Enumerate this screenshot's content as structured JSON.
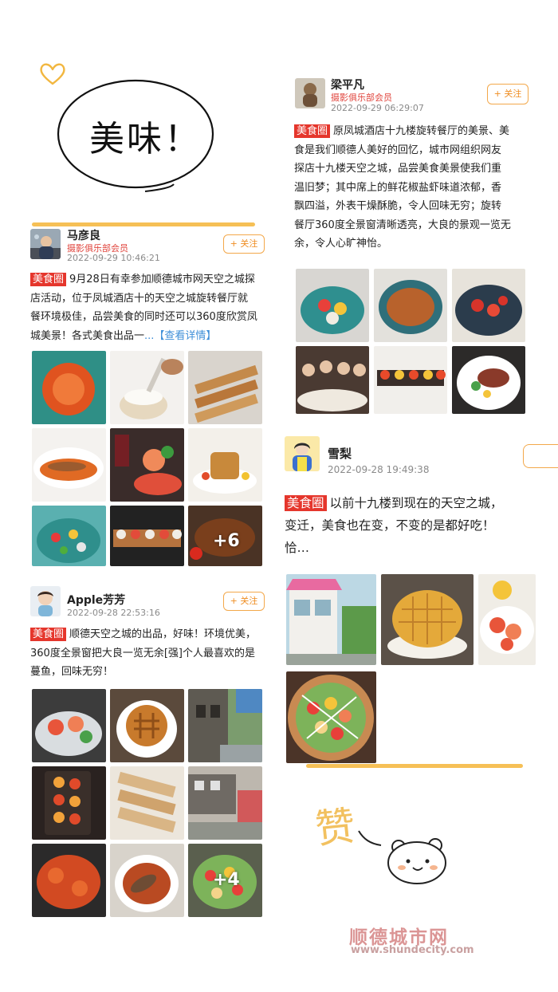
{
  "header": {
    "title": "美味！"
  },
  "posts": [
    {
      "name": "马彦良",
      "club": "摄影俱乐部会员",
      "time": "2022-09-29 10:46:21",
      "follow": "+ 关注",
      "tag": "美食圈",
      "lines": [
        "9月28日有幸参加顺德城市网天空之城探",
        "店活动，位于凤城酒店十的天空之城旋转餐厅就",
        "餐环境极佳，品尝美食的同时还可以360度欣赏凤",
        "城美景！各式美食出品一"
      ],
      "more": "...【查看详情】",
      "extra_count": "+6"
    },
    {
      "name": "Apple芳芳",
      "time": "2022-09-28 22:53:16",
      "follow": "+ 关注",
      "tag": "美食圈",
      "lines": [
        "顺德天空之城的出品，好味！环境优美，",
        "360度全景窗把大良一览无余[强]个人最喜欢的是",
        "蔓鱼，回味无穷！"
      ],
      "extra_count": "+4"
    },
    {
      "name": "梁平凡",
      "club": "摄影俱乐部会员",
      "time": "2022-09-29 06:29:07",
      "follow": "+ 关注",
      "tag": "美食圈",
      "lines": [
        "原凤城酒店十九楼旋转餐厅的美景、美",
        "食是我们顺德人美好的回忆，城市网组织网友",
        "探店十九楼天空之城，品尝美食美景使我们重",
        "温旧梦；其中席上的鲜花椒盐虾味道浓郁，香",
        "飘四溢，外表干燥酥脆，令人回味无穷；旋转",
        "餐厅360度全景窗清晰透亮，大良的景观一览无",
        "余，令人心旷神怡。"
      ]
    },
    {
      "name": "雪梨",
      "time": "2022-09-28 19:49:38",
      "tag": "美食圈",
      "lines": [
        "以前十九楼到现在的天空之城，",
        "变迁，美食也在变，不变的是都好吃！",
        "恰…"
      ]
    }
  ],
  "decor": {
    "zan": "赞"
  },
  "watermark": {
    "cn": "顺德城市网",
    "url": "www.shundecity.com"
  },
  "colors": {
    "tag_red": "#e5362c",
    "follow_orange": "#ef8d22",
    "highlight": "#f6c056",
    "link_blue": "#3f8fd8"
  },
  "icons": [
    "heart-icon",
    "bear-face-icon"
  ]
}
